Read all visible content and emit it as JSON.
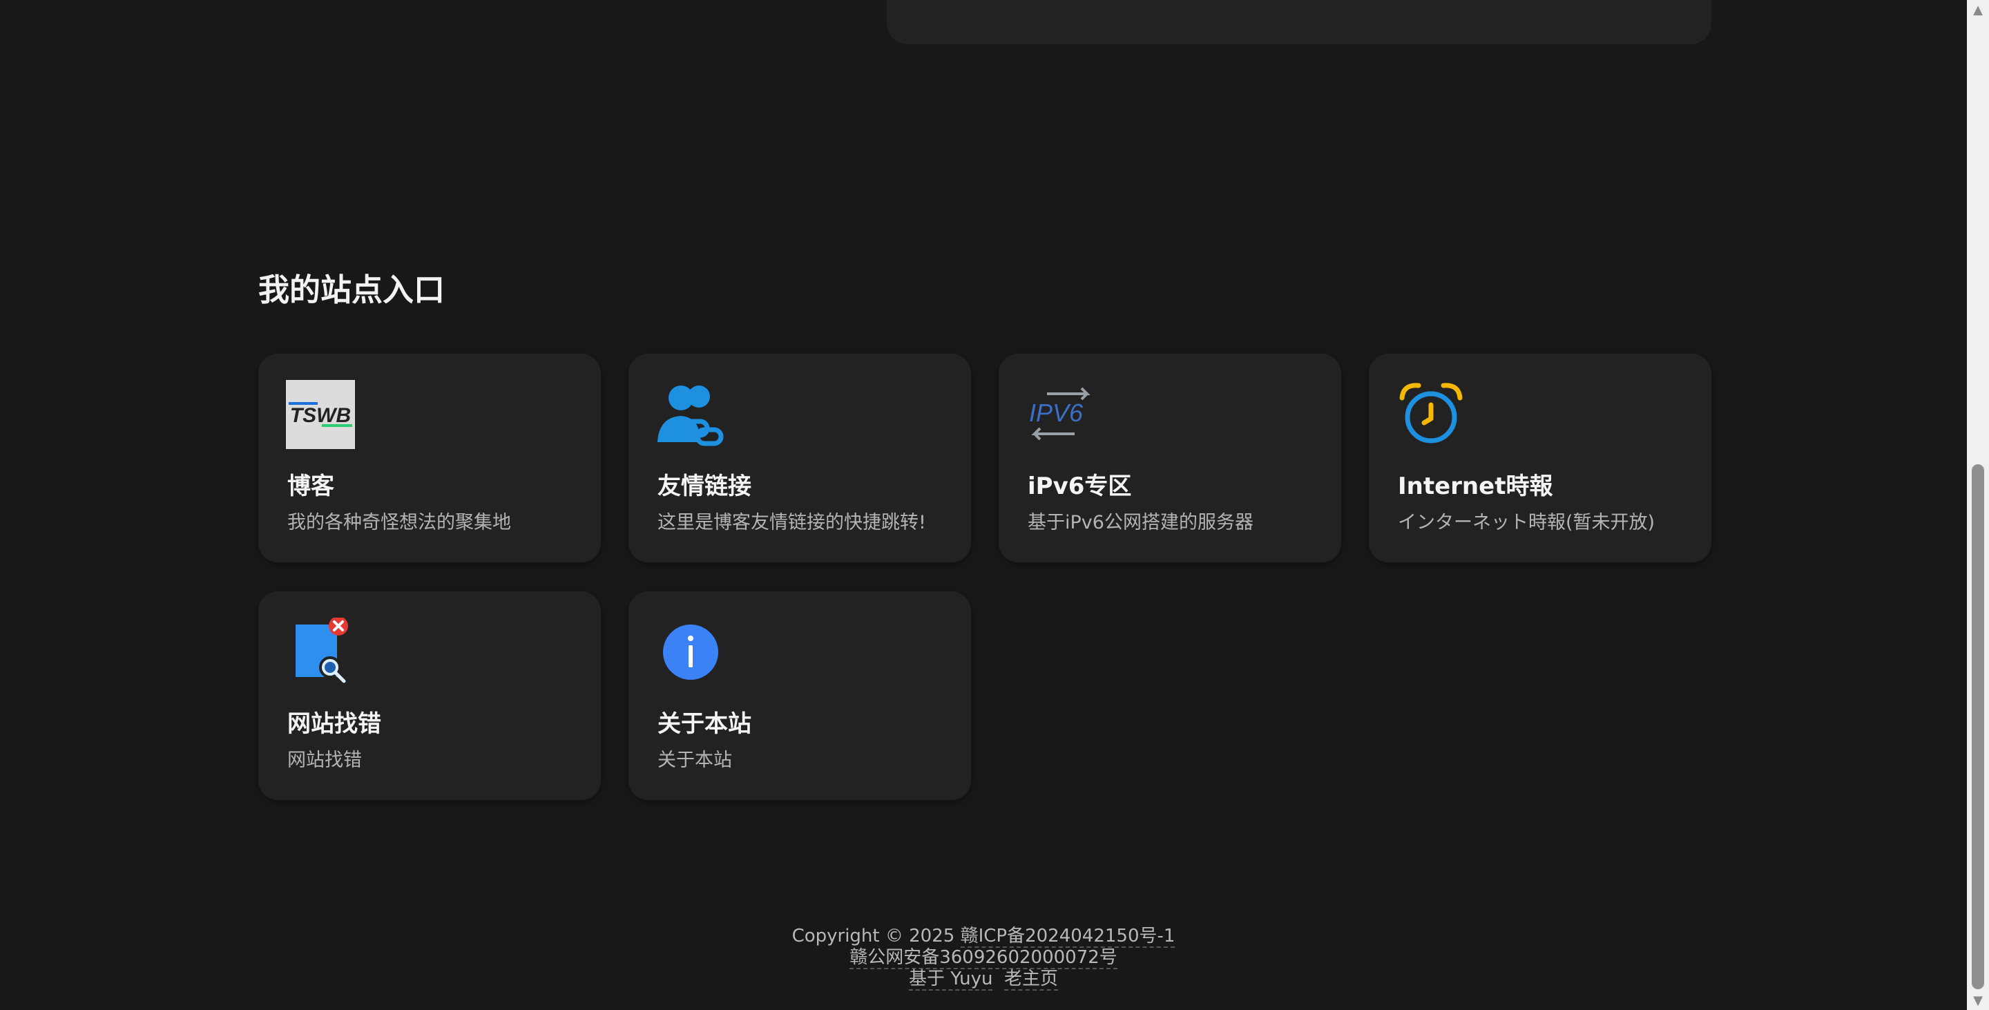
{
  "section": {
    "title": "我的站点入口"
  },
  "cards": [
    {
      "name": "博客",
      "desc": "我的各种奇怪想法的聚集地",
      "icon": "tswb-logo-icon",
      "logo_text": "TSWB"
    },
    {
      "name": "友情链接",
      "desc": "这里是博客友情链接的快捷跳转!",
      "icon": "friends-link-icon"
    },
    {
      "name": "iPv6专区",
      "desc": "基于iPv6公网搭建的服务器",
      "icon": "ipv6-icon",
      "logo_text": "IPV6"
    },
    {
      "name": "Internet時報",
      "desc": "インターネット時報(暂未开放)",
      "icon": "alarm-clock-icon"
    },
    {
      "name": "网站找错",
      "desc": "网站找错",
      "icon": "document-search-error-icon"
    },
    {
      "name": "关于本站",
      "desc": "关于本站",
      "icon": "info-icon"
    }
  ],
  "footer": {
    "copyright": "Copyright © 2025",
    "icp": "赣ICP备2024042150号-1",
    "police": "赣公网安备36092602000072号",
    "based_on_prefix": "基于",
    "based_on_link": "Yuyu",
    "old_home": "老主页"
  },
  "colors": {
    "background": "#181818",
    "card": "#222222",
    "accent_blue": "#1e90e0",
    "alarm_yellow": "#f5b800",
    "error_red": "#e53935",
    "ipv6_green": "#2ea44f"
  }
}
